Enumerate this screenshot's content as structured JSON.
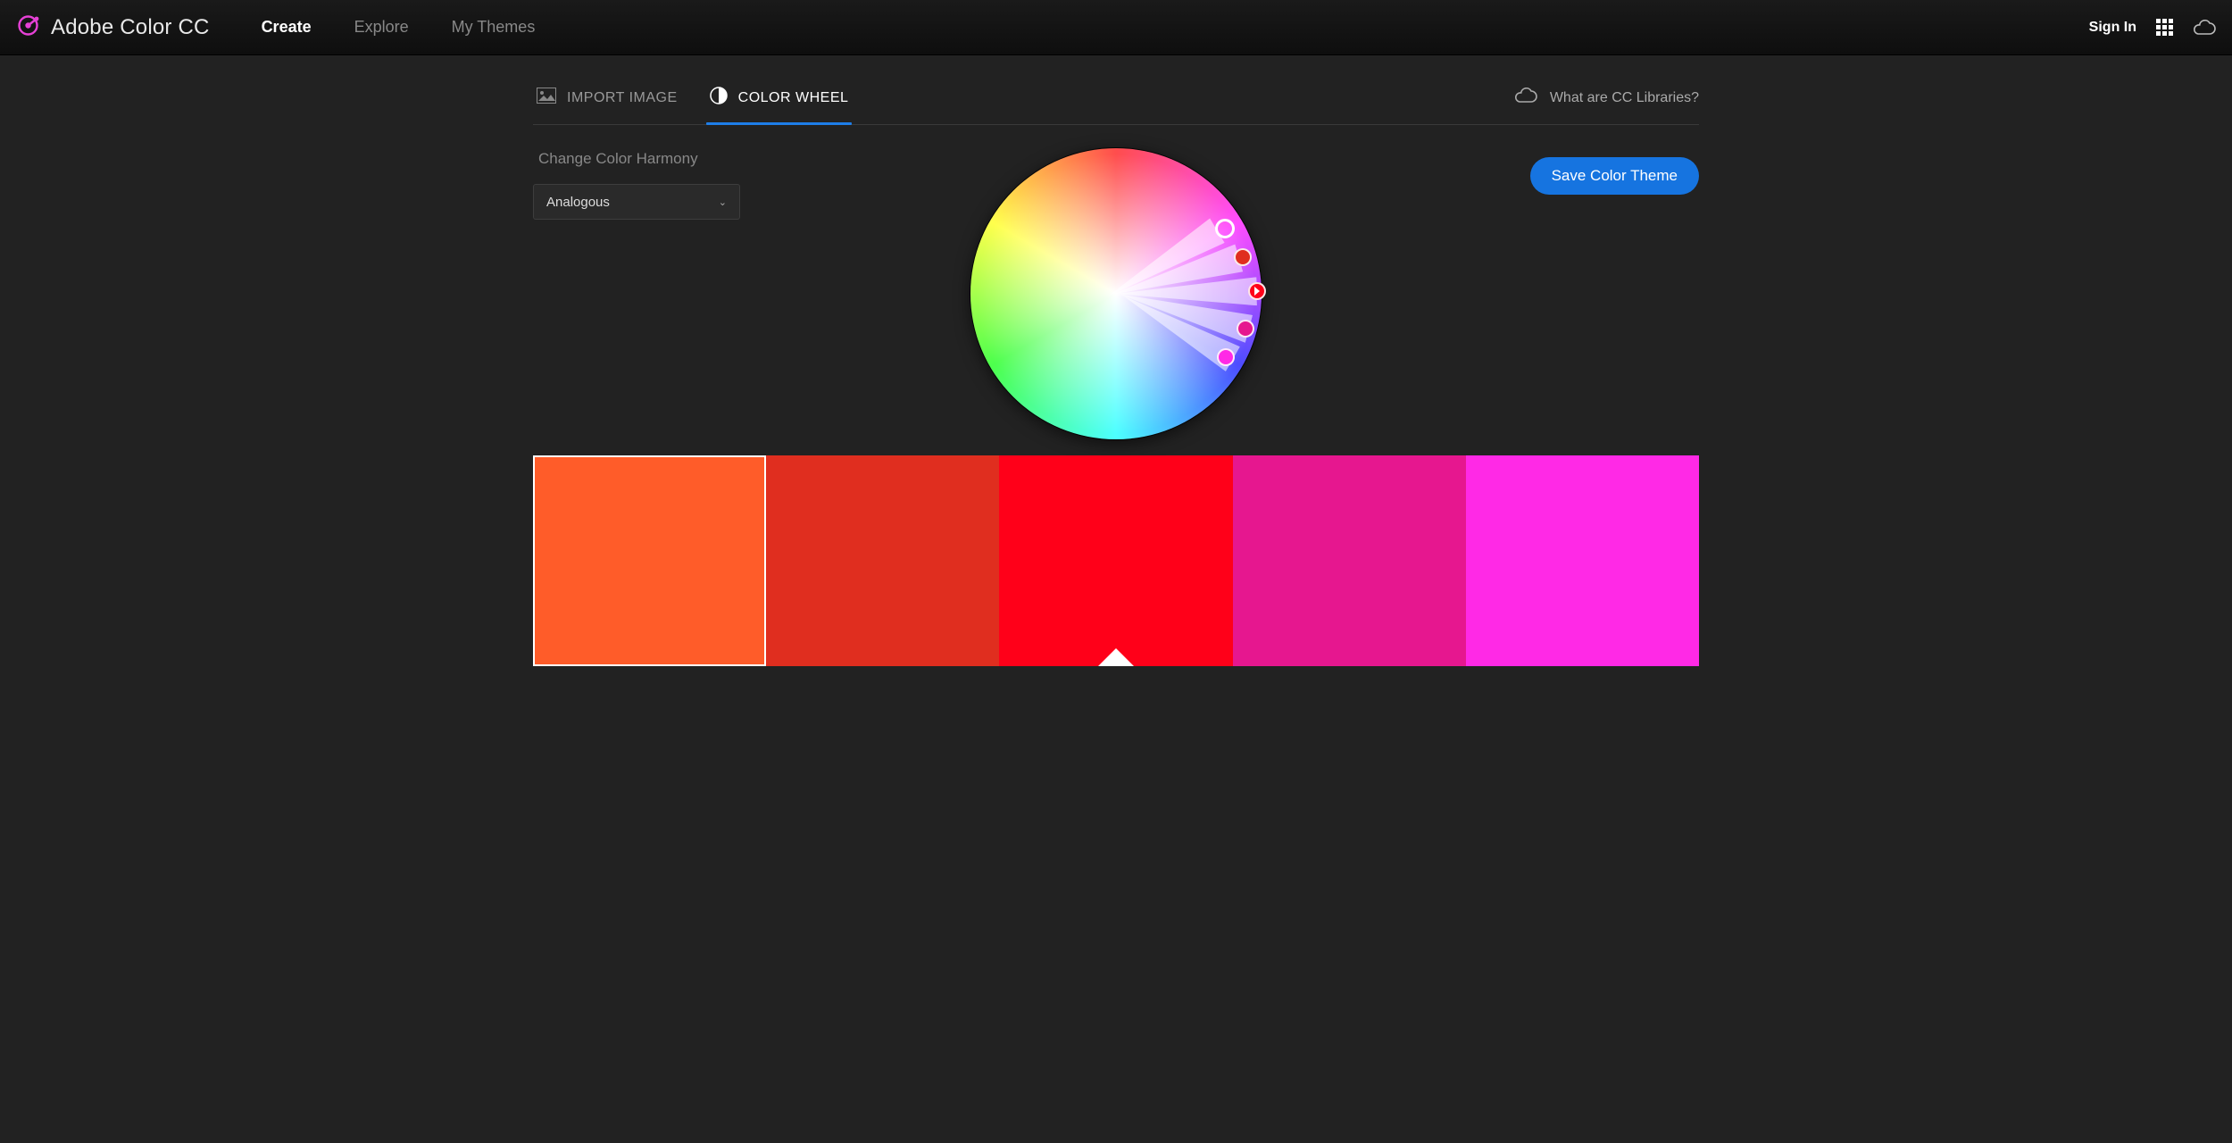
{
  "header": {
    "brand": "Adobe Color CC",
    "nav": [
      {
        "label": "Create",
        "active": true
      },
      {
        "label": "Explore",
        "active": false
      },
      {
        "label": "My Themes",
        "active": false
      }
    ],
    "signin": "Sign In"
  },
  "tabs": {
    "import": "IMPORT IMAGE",
    "wheel": "COLOR WHEEL",
    "active": "wheel",
    "cc_link": "What are CC Libraries?"
  },
  "controls": {
    "harmony_label": "Change Color Harmony",
    "harmony_value": "Analogous",
    "save_label": "Save Color Theme"
  },
  "wheel": {
    "markers": [
      {
        "angle": -31,
        "radius": 142,
        "color": "#ff5c29",
        "primary": true
      },
      {
        "angle": -16,
        "radius": 148,
        "color": "#e02e1f"
      },
      {
        "angle": -1,
        "radius": 158,
        "color": "#ff0019",
        "base": true
      },
      {
        "angle": 15,
        "radius": 150,
        "color": "#e6178f"
      },
      {
        "angle": 30,
        "radius": 142,
        "color": "#ff29e6"
      }
    ]
  },
  "swatches": [
    {
      "hex": "#FF5C29",
      "selected": true
    },
    {
      "hex": "#E02E1F"
    },
    {
      "hex": "#FF0019",
      "base": true
    },
    {
      "hex": "#E6178F"
    },
    {
      "hex": "#FF29E6"
    }
  ]
}
